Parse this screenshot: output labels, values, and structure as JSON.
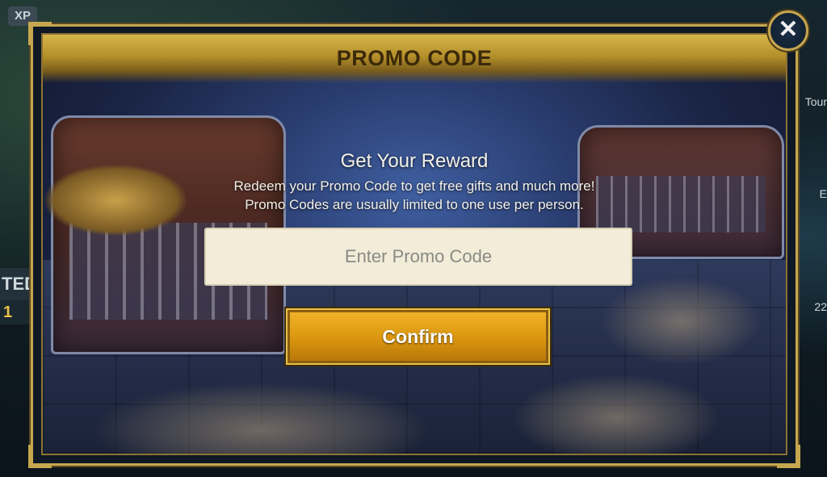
{
  "background": {
    "xp_badge": "XP",
    "left_fragment_1": "TED",
    "left_fragment_2": "1",
    "right_fragment_1": "Tour",
    "right_fragment_2": "E",
    "right_fragment_3": "22"
  },
  "modal": {
    "title": "PROMO CODE",
    "heading": "Get Your Reward",
    "description_line_1": "Redeem your Promo Code to get free gifts and much more!",
    "description_line_2": "Promo Codes are usually limited to one use per person.",
    "input": {
      "value": "",
      "placeholder": "Enter Promo Code"
    },
    "confirm_label": "Confirm",
    "close_icon": "close-icon"
  },
  "colors": {
    "accent_gold": "#c6a64f",
    "button_orange": "#d9950f",
    "input_bg": "#f2ecd8",
    "title_text": "#3b2a0a"
  }
}
